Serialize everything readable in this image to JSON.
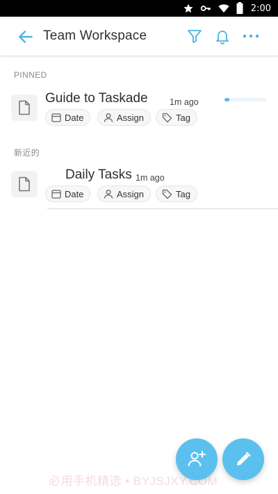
{
  "status_bar": {
    "time": "2:00"
  },
  "app_bar": {
    "title": "Team Workspace"
  },
  "sections": {
    "pinned": "PINNED",
    "recent": "新近的"
  },
  "tasks": [
    {
      "title": "Guide to Taskade",
      "time": "1m ago",
      "progress": 0.12,
      "chips": {
        "date": "Date",
        "assign": "Assign",
        "tag": "Tag"
      }
    },
    {
      "title": "Daily Tasks",
      "time": "1m ago",
      "chips": {
        "date": "Date",
        "assign": "Assign",
        "tag": "Tag"
      }
    }
  ],
  "watermark": "必用手机精选 • BYJSJXY.COM",
  "colors": {
    "accent": "#5bb8e6",
    "fab": "#5cc0ef"
  },
  "icons": [
    "star-icon",
    "key-icon",
    "wifi-icon",
    "battery-icon",
    "back-arrow-icon",
    "filter-icon",
    "bell-icon",
    "more-icon",
    "document-icon",
    "calendar-icon",
    "person-icon",
    "tag-icon",
    "add-person-icon",
    "pencil-icon"
  ]
}
